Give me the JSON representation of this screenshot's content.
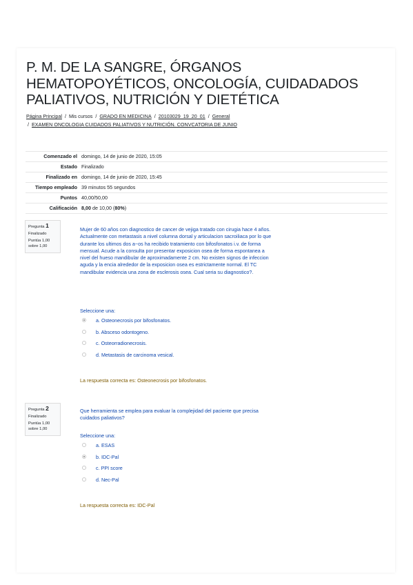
{
  "title": "P. M. DE LA SANGRE, ÓRGANOS HEMATOPOYÉTICOS, ONCOLOGÍA, CUIDADADOS PALIATIVOS, NUTRICIÓN Y DIETÉTICA",
  "breadcrumb": {
    "items": [
      "Página Principal",
      "Mis cursos",
      "GRADO EN MEDICINA",
      "20103029_19_20_01",
      "General",
      "EXAMEN ONCOLOGIA CUIDADOS PALIATIVOS Y NUTRICIÓN. CONVCATORIA DE JUNIO"
    ],
    "separator": "/"
  },
  "summary": [
    {
      "label": "Comenzado el",
      "value": "domingo, 14 de junio de 2020, 15:05"
    },
    {
      "label": "Estado",
      "value": "Finalizado"
    },
    {
      "label": "Finalizado en",
      "value": "domingo, 14 de junio de 2020, 15:45"
    },
    {
      "label": "Tiempo empleado",
      "value": "39 minutos 55 segundos"
    },
    {
      "label": "Puntos",
      "value": "40,00/50,00"
    },
    {
      "label": "Calificación",
      "value_bold": "8,00",
      "value_mid": " de 10,00 (",
      "value_pct": "80%",
      "value_end": ")"
    }
  ],
  "questions": [
    {
      "label": "Pregunta",
      "number": "1",
      "state": "Finalizado",
      "score": "Puntúa 1,00 sobre 1,00",
      "text": "Mujer de 60 años con diagnostico de cancer de vejiga tratado con cirugia hace 4 años. Actualmente con metastasis a nivel columna dorsal y articulacion sacroiliaca por lo que durante los ultimos dos a~os ha recibido tratamiento con bifosfonatos i.v. de forma mensual. Acude a la consulta por presentar exposicion osea de forma espontanea a nivel del hueso mandibular de aproximadamente 2 cm. No existen signos de infeccion aguda y la encia alrededor de la exposicion osea es estrictamente normal. El TC mandibular evidencia una zona de esclerosis osea. Cual seria su diagnostico?.",
      "prompt": "Seleccione una:",
      "options": [
        "a. Osteonecrosis por bifosfonatos.",
        "b. Absceso odontogeno.",
        "c. Osteorradionecrosis.",
        "d. Metastasis de carcinoma vesical."
      ],
      "selected": 0,
      "feedback": "La respuesta correcta es: Osteonecrosis por bifosfonatos."
    },
    {
      "label": "Pregunta",
      "number": "2",
      "state": "Finalizado",
      "score": "Puntúa 1,00 sobre 1,00",
      "text": "Que herramienta se emplea para evaluar la complejidad del paciente que precisa cuidados paliativos?",
      "prompt": "Seleccione una:",
      "options": [
        "a. ESAS",
        "b. IDC-Pal",
        "c. PPI score",
        "d. Nec-Pal"
      ],
      "selected": 1,
      "feedback": "La respuesta correcta es: IDC-Pal"
    }
  ]
}
